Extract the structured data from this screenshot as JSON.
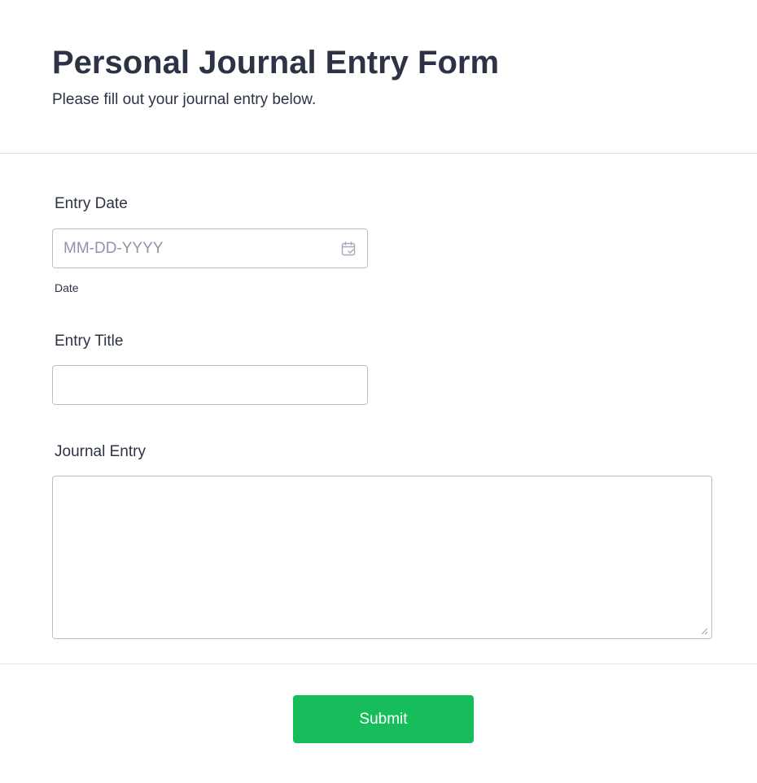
{
  "header": {
    "title": "Personal Journal Entry Form",
    "subtitle": "Please fill out your journal entry below."
  },
  "fields": {
    "entry_date": {
      "label": "Entry Date",
      "placeholder": "MM-DD-YYYY",
      "value": "",
      "sublabel": "Date",
      "icon": "calendar-check-icon"
    },
    "entry_title": {
      "label": "Entry Title",
      "value": ""
    },
    "journal_entry": {
      "label": "Journal Entry",
      "value": ""
    }
  },
  "footer": {
    "submit_label": "Submit"
  },
  "colors": {
    "text": "#2c3345",
    "placeholder": "#8d96a8",
    "input_border": "#b8bdc9",
    "divider": "#dfe1e6",
    "submit_bg": "#18bd5b",
    "submit_text": "#ffffff"
  }
}
